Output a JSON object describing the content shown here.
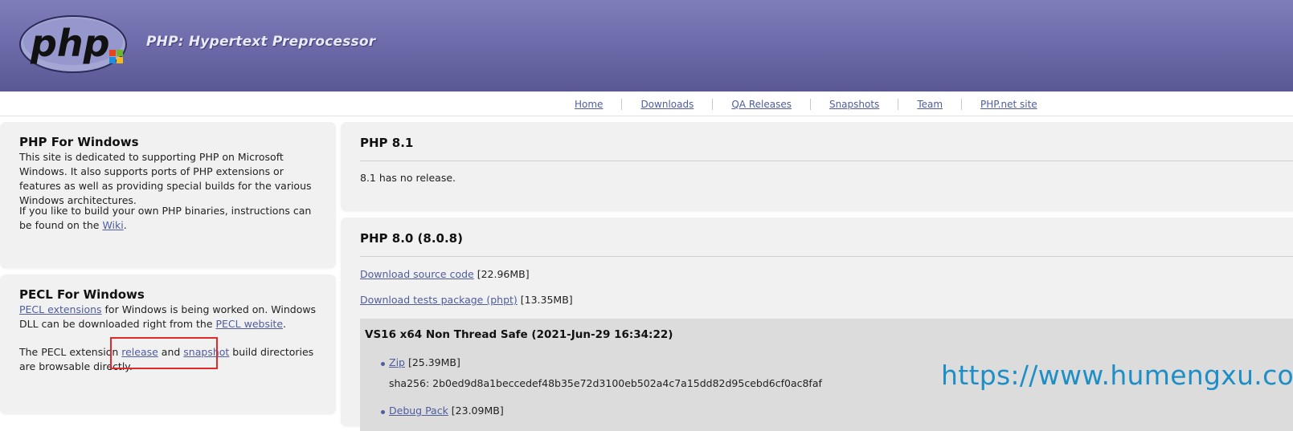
{
  "header": {
    "site_title": "PHP: Hypertext Preprocessor",
    "logo_text": "php"
  },
  "nav": {
    "items": [
      "Home",
      "Downloads",
      "QA Releases",
      "Snapshots",
      "Team",
      "PHP.net site"
    ]
  },
  "php_windows": {
    "title": "PHP For Windows",
    "p1": "This site is dedicated to supporting PHP on Microsoft Windows. It also supports ports of PHP extensions or features as well as providing special builds for the various Windows architectures.",
    "p2_before": "If you like to build your own PHP binaries, instructions can be found on the ",
    "p2_link": "Wiki",
    "p2_after": "."
  },
  "pecl": {
    "title": "PECL For Windows",
    "p1_link1": "PECL extensions",
    "p1_mid": " for Windows is being worked on. Windows DLL can be downloaded right from the ",
    "p1_link2": "PECL website",
    "p1_after": ".",
    "p2_before": "The PECL extension ",
    "p2_link1": "release",
    "p2_mid": " and ",
    "p2_link2": "snapshot",
    "p2_after": " build directories are browsable directly."
  },
  "php81": {
    "title": "PHP 8.1",
    "text": "8.1 has no release."
  },
  "php80": {
    "title": "PHP 8.0 (8.0.8)",
    "source_link": "Download source code",
    "source_size": " [22.96MB]",
    "tests_link": "Download tests package (phpt)",
    "tests_size": " [13.35MB]",
    "build_title": "VS16 x64 Non Thread Safe (2021-Jun-29 16:34:22)",
    "zip_link": "Zip",
    "zip_size": " [25.39MB]",
    "sha": "sha256: 2b0ed9d8a1beccedef48b35e72d3100eb502a4c7a15dd82d95cebd6cf0ac8faf",
    "debug_link": "Debug Pack",
    "debug_size": " [23.09MB]"
  },
  "watermark": "https://www.humengxu.com",
  "colors": {
    "header": "#6c6aa8",
    "link": "#4f5c9e",
    "panel": "#f1f1f1",
    "highlight": "#e02a2a",
    "watermark": "#1d8ec6"
  }
}
